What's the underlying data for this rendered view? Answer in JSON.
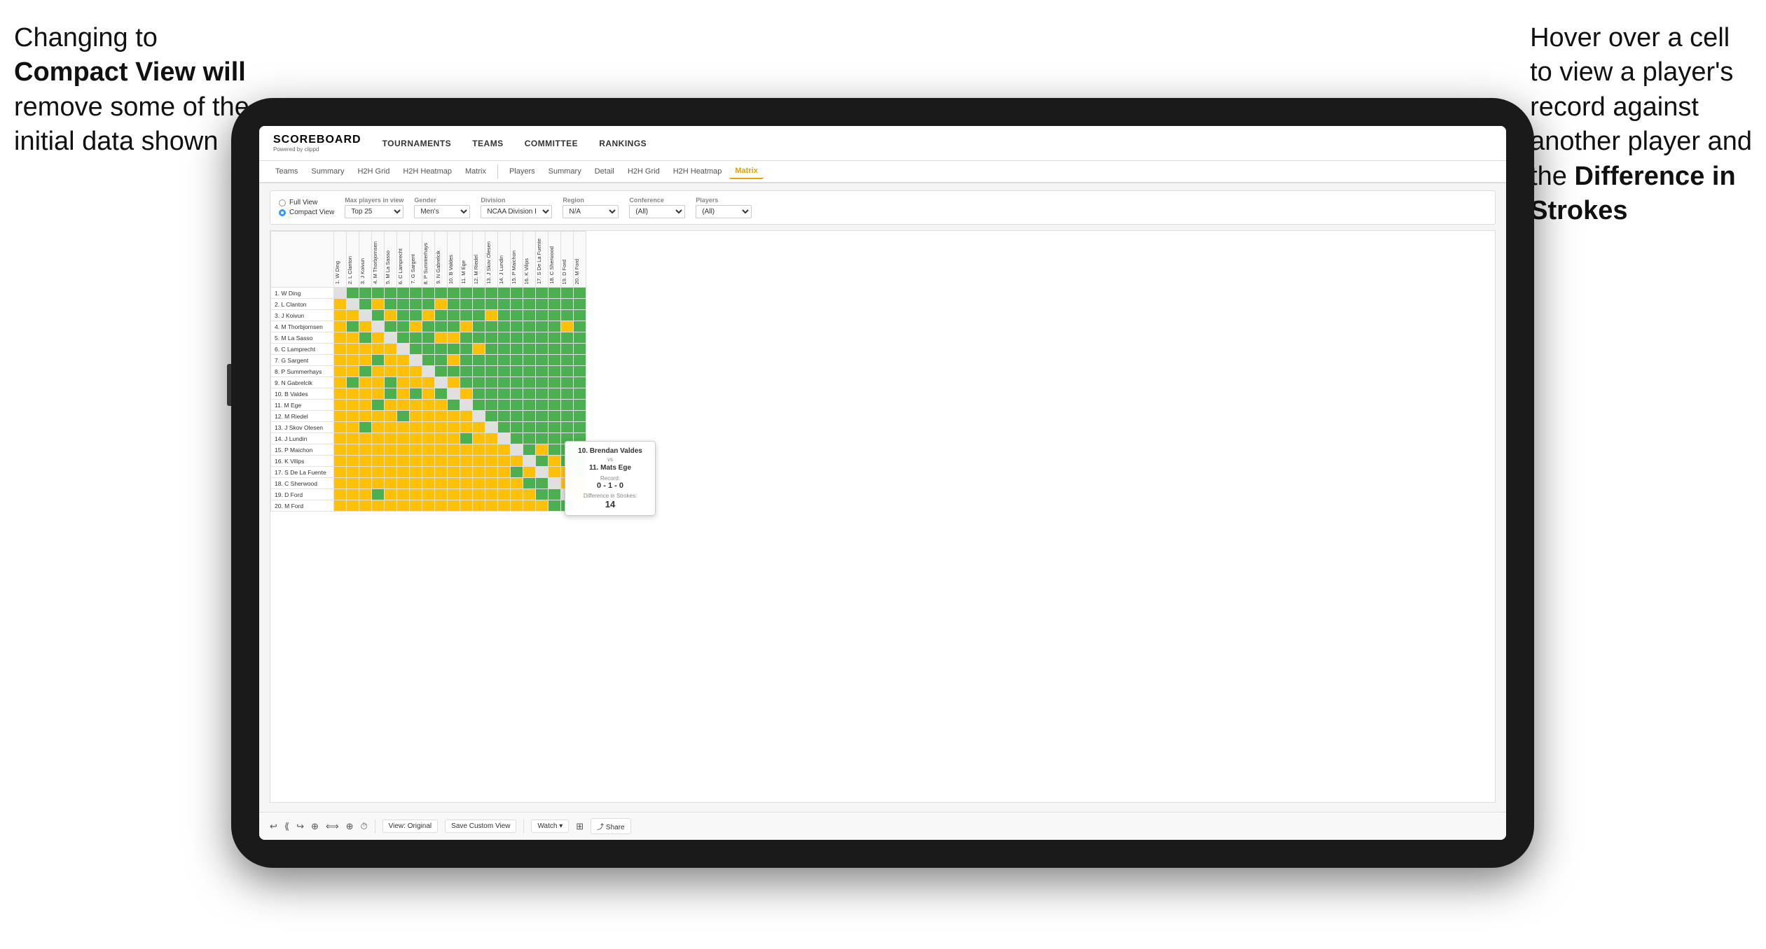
{
  "annotations": {
    "left": {
      "line1": "Changing to",
      "line2": "Compact View will",
      "line3": "remove some of the",
      "line4": "initial data shown"
    },
    "right": {
      "line1": "Hover over a cell",
      "line2": "to view a player's",
      "line3": "record against",
      "line4": "another player and",
      "line5": "the ",
      "line6Bold": "Difference in",
      "line7Bold": "Strokes"
    }
  },
  "header": {
    "logo": "SCOREBOARD",
    "logo_sub": "Powered by clippd",
    "nav": [
      "TOURNAMENTS",
      "TEAMS",
      "COMMITTEE",
      "RANKINGS"
    ]
  },
  "sub_nav": {
    "groups": [
      [
        "Teams",
        "Summary",
        "H2H Grid",
        "H2H Heatmap",
        "Matrix"
      ],
      [
        "Players",
        "Summary",
        "Detail",
        "H2H Grid",
        "H2H Heatmap",
        "Matrix"
      ]
    ],
    "active": "Matrix"
  },
  "filters": {
    "view_options": [
      "Full View",
      "Compact View"
    ],
    "selected_view": "Compact View",
    "max_players_label": "Max players in view",
    "max_players_value": "Top 25",
    "gender_label": "Gender",
    "gender_value": "Men's",
    "division_label": "Division",
    "division_value": "NCAA Division I",
    "region_label": "Region",
    "region_value": "N/A",
    "conference_label": "Conference",
    "conference_value": "(All)",
    "players_label": "Players",
    "players_value": "(All)"
  },
  "matrix": {
    "col_headers": [
      "1. W Ding",
      "2. L Clanton",
      "3. J Koivun",
      "4. M Thorbjornsen",
      "5. M La Sasso",
      "6. C Lamprecht",
      "7. G Sargent",
      "8. P Summerhays",
      "9. N Gabrelcik",
      "10. B Valdes",
      "11. M Ege",
      "12. M Riedel",
      "13. J Skov Olesen",
      "14. J Lundin",
      "15. P Maichon",
      "16. K Vilips",
      "17. S De La Fuente",
      "18. C Sherwood",
      "19. D Ford",
      "20. M Ford"
    ],
    "rows": [
      {
        "label": "1. W Ding",
        "cells": [
          "D",
          "G",
          "G",
          "G",
          "G",
          "G",
          "G",
          "G",
          "G",
          "G",
          "G",
          "G",
          "G",
          "G",
          "G",
          "G",
          "G",
          "G",
          "G",
          "G"
        ]
      },
      {
        "label": "2. L Clanton",
        "cells": [
          "Y",
          "D",
          "G",
          "Y",
          "G",
          "G",
          "G",
          "G",
          "Y",
          "G",
          "G",
          "G",
          "G",
          "G",
          "G",
          "G",
          "G",
          "G",
          "G",
          "G"
        ]
      },
      {
        "label": "3. J Koivun",
        "cells": [
          "Y",
          "Y",
          "D",
          "G",
          "Y",
          "G",
          "G",
          "Y",
          "G",
          "G",
          "G",
          "G",
          "Y",
          "G",
          "G",
          "G",
          "G",
          "G",
          "G",
          "G"
        ]
      },
      {
        "label": "4. M Thorbjornsen",
        "cells": [
          "Y",
          "G",
          "Y",
          "D",
          "G",
          "G",
          "Y",
          "G",
          "G",
          "G",
          "Y",
          "G",
          "G",
          "G",
          "G",
          "G",
          "G",
          "G",
          "Y",
          "G"
        ]
      },
      {
        "label": "5. M La Sasso",
        "cells": [
          "Y",
          "Y",
          "G",
          "Y",
          "D",
          "G",
          "G",
          "G",
          "Y",
          "Y",
          "G",
          "G",
          "G",
          "G",
          "G",
          "G",
          "G",
          "G",
          "G",
          "G"
        ]
      },
      {
        "label": "6. C Lamprecht",
        "cells": [
          "Y",
          "Y",
          "Y",
          "Y",
          "Y",
          "D",
          "G",
          "G",
          "G",
          "G",
          "G",
          "Y",
          "G",
          "G",
          "G",
          "G",
          "G",
          "G",
          "G",
          "G"
        ]
      },
      {
        "label": "7. G Sargent",
        "cells": [
          "Y",
          "Y",
          "Y",
          "G",
          "Y",
          "Y",
          "D",
          "G",
          "G",
          "Y",
          "G",
          "G",
          "G",
          "G",
          "G",
          "G",
          "G",
          "G",
          "G",
          "G"
        ]
      },
      {
        "label": "8. P Summerhays",
        "cells": [
          "Y",
          "Y",
          "G",
          "Y",
          "Y",
          "Y",
          "Y",
          "D",
          "G",
          "G",
          "G",
          "G",
          "G",
          "G",
          "G",
          "G",
          "G",
          "G",
          "G",
          "G"
        ]
      },
      {
        "label": "9. N Gabrelcik",
        "cells": [
          "Y",
          "G",
          "Y",
          "Y",
          "G",
          "Y",
          "Y",
          "Y",
          "D",
          "Y",
          "G",
          "G",
          "G",
          "G",
          "G",
          "G",
          "G",
          "G",
          "G",
          "G"
        ]
      },
      {
        "label": "10. B Valdes",
        "cells": [
          "Y",
          "Y",
          "Y",
          "Y",
          "G",
          "Y",
          "G",
          "Y",
          "G",
          "D",
          "Y",
          "G",
          "G",
          "G",
          "G",
          "G",
          "G",
          "G",
          "G",
          "G"
        ]
      },
      {
        "label": "11. M Ege",
        "cells": [
          "Y",
          "Y",
          "Y",
          "G",
          "Y",
          "Y",
          "Y",
          "Y",
          "Y",
          "G",
          "D",
          "G",
          "G",
          "G",
          "G",
          "G",
          "G",
          "G",
          "G",
          "G"
        ]
      },
      {
        "label": "12. M Riedel",
        "cells": [
          "Y",
          "Y",
          "Y",
          "Y",
          "Y",
          "G",
          "Y",
          "Y",
          "Y",
          "Y",
          "Y",
          "D",
          "G",
          "G",
          "G",
          "G",
          "G",
          "G",
          "G",
          "G"
        ]
      },
      {
        "label": "13. J Skov Olesen",
        "cells": [
          "Y",
          "Y",
          "G",
          "Y",
          "Y",
          "Y",
          "Y",
          "Y",
          "Y",
          "Y",
          "Y",
          "Y",
          "D",
          "G",
          "G",
          "G",
          "G",
          "G",
          "G",
          "G"
        ]
      },
      {
        "label": "14. J Lundin",
        "cells": [
          "Y",
          "Y",
          "Y",
          "Y",
          "Y",
          "Y",
          "Y",
          "Y",
          "Y",
          "Y",
          "G",
          "Y",
          "Y",
          "D",
          "G",
          "G",
          "G",
          "G",
          "G",
          "G"
        ]
      },
      {
        "label": "15. P Maichon",
        "cells": [
          "Y",
          "Y",
          "Y",
          "Y",
          "Y",
          "Y",
          "Y",
          "Y",
          "Y",
          "Y",
          "Y",
          "Y",
          "Y",
          "Y",
          "D",
          "G",
          "Y",
          "G",
          "G",
          "G"
        ]
      },
      {
        "label": "16. K Vilips",
        "cells": [
          "Y",
          "Y",
          "Y",
          "Y",
          "Y",
          "Y",
          "Y",
          "Y",
          "Y",
          "Y",
          "Y",
          "Y",
          "Y",
          "Y",
          "Y",
          "D",
          "G",
          "Y",
          "G",
          "G"
        ]
      },
      {
        "label": "17. S De La Fuente",
        "cells": [
          "Y",
          "Y",
          "Y",
          "Y",
          "Y",
          "Y",
          "Y",
          "Y",
          "Y",
          "Y",
          "Y",
          "Y",
          "Y",
          "Y",
          "G",
          "Y",
          "D",
          "Y",
          "Y",
          "G"
        ]
      },
      {
        "label": "18. C Sherwood",
        "cells": [
          "Y",
          "Y",
          "Y",
          "Y",
          "Y",
          "Y",
          "Y",
          "Y",
          "Y",
          "Y",
          "Y",
          "Y",
          "Y",
          "Y",
          "Y",
          "G",
          "G",
          "D",
          "Y",
          "Y"
        ]
      },
      {
        "label": "19. D Ford",
        "cells": [
          "Y",
          "Y",
          "Y",
          "G",
          "Y",
          "Y",
          "Y",
          "Y",
          "Y",
          "Y",
          "Y",
          "Y",
          "Y",
          "Y",
          "Y",
          "Y",
          "G",
          "G",
          "D",
          "Y"
        ]
      },
      {
        "label": "20. M Ford",
        "cells": [
          "Y",
          "Y",
          "Y",
          "Y",
          "Y",
          "Y",
          "Y",
          "Y",
          "Y",
          "Y",
          "Y",
          "Y",
          "Y",
          "Y",
          "Y",
          "Y",
          "Y",
          "G",
          "G",
          "D"
        ]
      }
    ]
  },
  "tooltip": {
    "player1": "10. Brendan Valdes",
    "vs": "vs",
    "player2": "11. Mats Ege",
    "record_label": "Record:",
    "record": "0 - 1 - 0",
    "diff_label": "Difference in Strokes:",
    "diff_value": "14"
  },
  "toolbar": {
    "buttons": [
      "View: Original",
      "Save Custom View",
      "Watch ▾"
    ],
    "icons": [
      "↩",
      "↪",
      "↩",
      "⊕",
      "←·→",
      "⊕",
      "⏱"
    ]
  }
}
